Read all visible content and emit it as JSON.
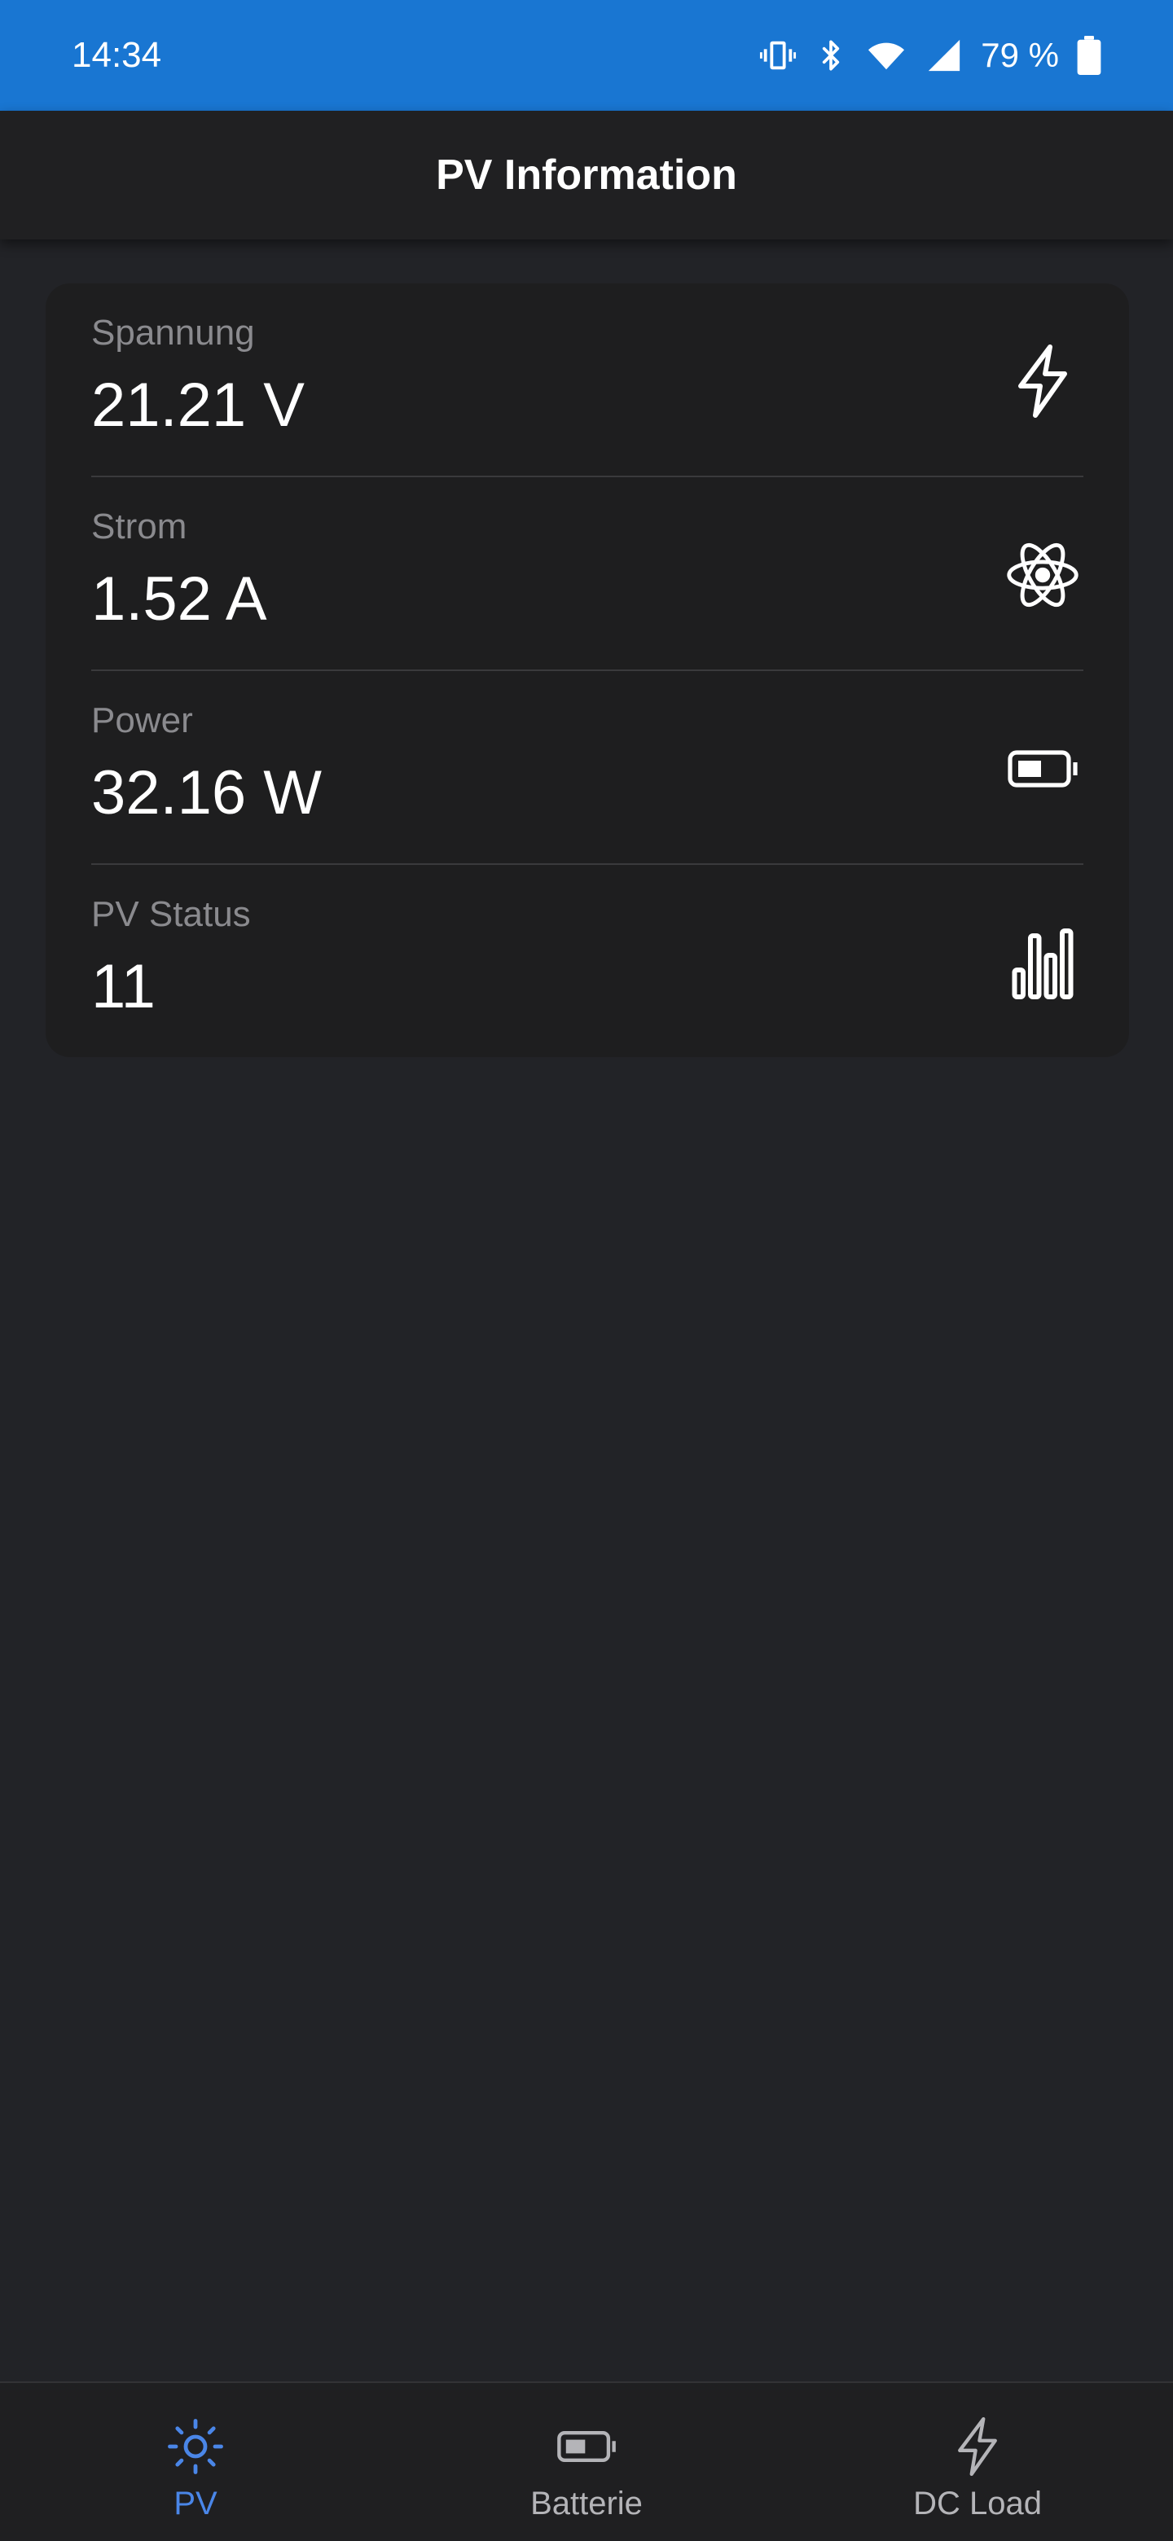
{
  "status_bar": {
    "time": "14:34",
    "battery_percent": "79 %",
    "icons": [
      "vibrate-icon",
      "bluetooth-icon",
      "wifi-icon",
      "signal-icon",
      "battery-icon"
    ]
  },
  "app_bar": {
    "title": "PV Information"
  },
  "metrics": [
    {
      "label": "Spannung",
      "value": "21.21 V",
      "icon": "lightning-icon"
    },
    {
      "label": "Strom",
      "value": "1.52 A",
      "icon": "atom-icon"
    },
    {
      "label": "Power",
      "value": "32.16 W",
      "icon": "battery-icon"
    },
    {
      "label": "PV Status",
      "value": "11",
      "icon": "bar-chart-icon"
    }
  ],
  "bottom_nav": {
    "items": [
      {
        "label": "PV",
        "icon": "sun-icon",
        "active": true
      },
      {
        "label": "Batterie",
        "icon": "battery-icon",
        "active": false
      },
      {
        "label": "DC Load",
        "icon": "lightning-icon",
        "active": false
      }
    ]
  },
  "colors": {
    "status_bar": "#1976d2",
    "active_nav": "#4a86e8",
    "background": "#222327",
    "card": "#1e1e1f"
  }
}
